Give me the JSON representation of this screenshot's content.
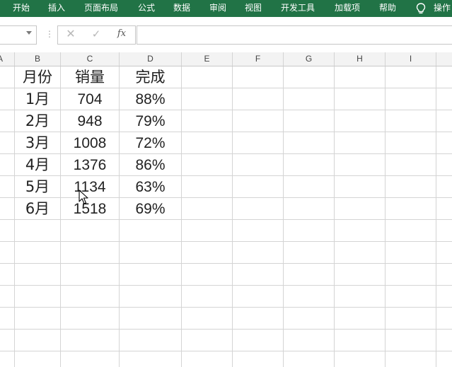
{
  "ribbon": {
    "tabs": [
      "开始",
      "插入",
      "页面布局",
      "公式",
      "数据",
      "审阅",
      "视图",
      "开发工具",
      "加载项",
      "帮助"
    ],
    "tell_me": "操作"
  },
  "formula_bar": {
    "name_box": "",
    "formula": "",
    "icons": [
      "close-icon",
      "checkmark-icon",
      "fx-icon"
    ]
  },
  "columns": [
    "A",
    "B",
    "C",
    "D",
    "E",
    "F",
    "G",
    "H",
    "I"
  ],
  "table": {
    "headers": [
      "月份",
      "销量",
      "完成"
    ],
    "rows": [
      [
        "1月",
        "704",
        "88%"
      ],
      [
        "2月",
        "948",
        "79%"
      ],
      [
        "3月",
        "1008",
        "72%"
      ],
      [
        "4月",
        "1376",
        "86%"
      ],
      [
        "5月",
        "1134",
        "63%"
      ],
      [
        "6月",
        "1518",
        "69%"
      ]
    ]
  }
}
